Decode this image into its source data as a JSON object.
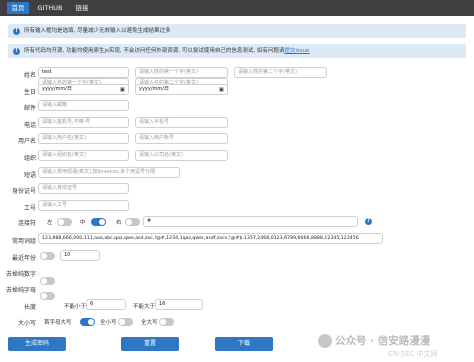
{
  "nav": {
    "items": [
      "首页",
      "GITHUB",
      "链接"
    ],
    "active": 0
  },
  "banners": {
    "tip1": "所有输入框均是选填, 尽量减少无效输入以避免生成结果过多",
    "tip2_text": "所有代码均开源, 功能均使用原生js实现, 不会访问任何外部资源, 可以尝试使用自己的信息测试, 如有问题请",
    "tip2_link": "提交issue"
  },
  "form": {
    "name": {
      "label": "姓名",
      "value": "test",
      "ph1": "请输入姓的第一个字(英文)",
      "ph2": "请输入姓的第二个字(英文)",
      "ph3": "请输入名的第一个字(英文)",
      "ph4": "请输入名的第二个字(英文)"
    },
    "birthday": {
      "label": "生日",
      "ph1": "yyyy/mm/日",
      "ph2": "yyyy/mm/日"
    },
    "email": {
      "label": "邮件",
      "ph": "请输入邮箱"
    },
    "phone": {
      "label": "电话",
      "ph1": "请输入座机号,不带-号",
      "ph2": "请输入手机号"
    },
    "username": {
      "label": "用户名",
      "ph1": "请输入用户名(英文)",
      "ph2": "请输入用户账号"
    },
    "org": {
      "label": "组织",
      "ph1": "请输入组织名(英文)",
      "ph2": "请输入公司名(英文)"
    },
    "phrase": {
      "label": "短语",
      "ph": "请输入常用短语(英文),如iloveyou,多个用逗号分隔"
    },
    "idcard": {
      "label": "身份证号",
      "ph": "请输入身份证号"
    },
    "jobno": {
      "label": "工号",
      "ph": "请输入工号"
    },
    "joiner": {
      "label": "连接符",
      "left": "左",
      "mid": "中",
      "right": "右",
      "value": "#",
      "help": "?"
    },
    "common": {
      "label": "常用词组",
      "value": "123,888,666,000,111,aaa,abc,qaz,qwe,asd,zxc,!@#,1234,1qaz,qwer,asdf,zxcv,!@#$,1357,2468,0123,6789,6666,8888,12345,123456"
    },
    "maxyear": {
      "label": "最近年份",
      "value": "10"
    },
    "rmdigits": {
      "label": "去掉纯数字"
    },
    "rmletters": {
      "label": "去掉纯字母"
    },
    "length": {
      "label": "长度",
      "min_label": "不能小于",
      "min": "6",
      "max_label": "不能大于",
      "max": "16"
    },
    "case": {
      "label": "大小写",
      "opt1": "首字母大写",
      "opt2": "全小写",
      "opt3": "全大写"
    }
  },
  "buttons": {
    "generate": "生成密码",
    "reset": "重置",
    "download": "下载"
  },
  "watermark": {
    "text1": "公众号 · 信安路漫漫",
    "text2": "CN-SEC 中文网"
  },
  "colors": {
    "nav_bg": "#3f3f3f",
    "accent": "#2e77c5",
    "banner_bg": "#dde9f7"
  }
}
